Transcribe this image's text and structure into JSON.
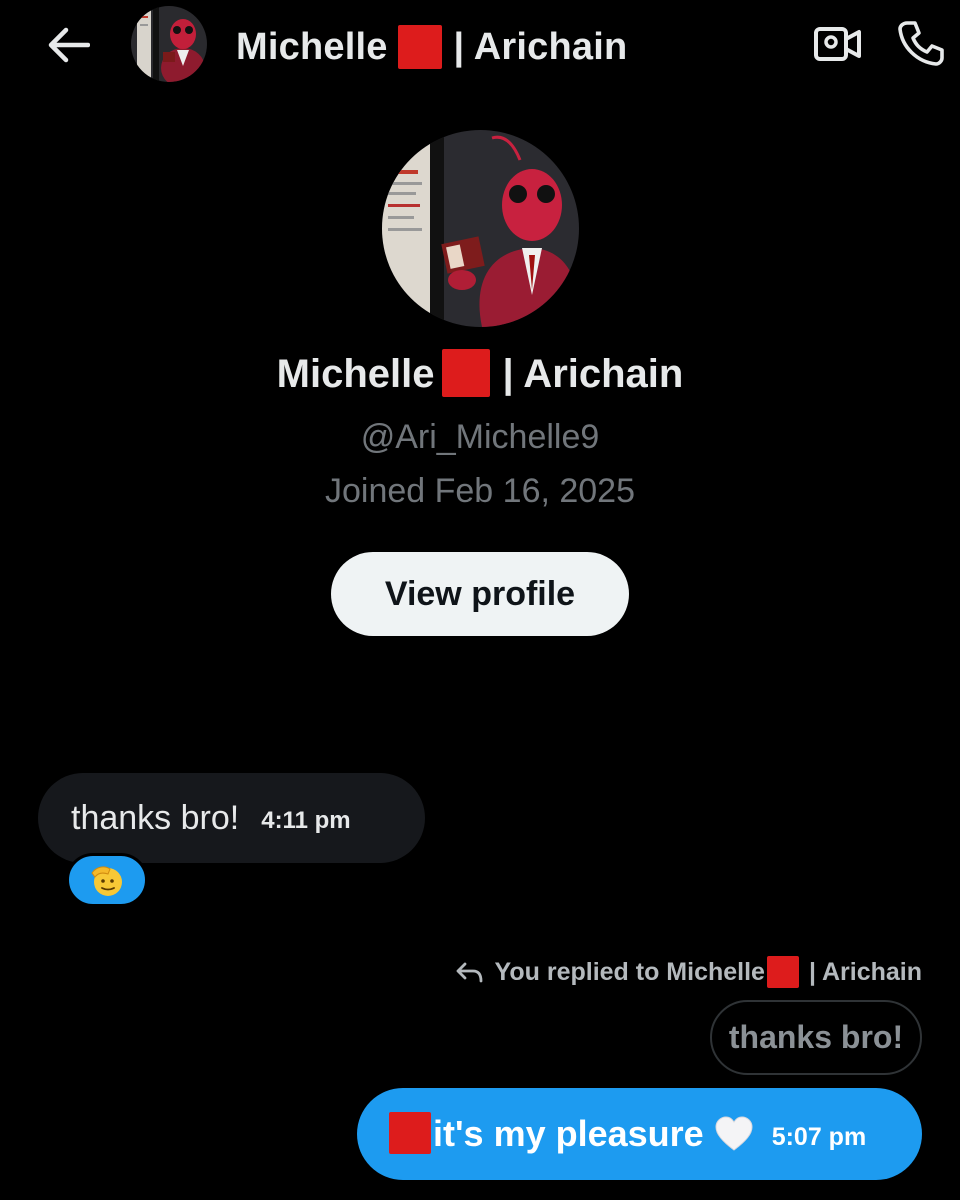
{
  "header": {
    "back_icon": "arrow-left-icon",
    "title_name": "Michelle",
    "title_suffix": "| Arichain",
    "video_icon": "video-camera-icon",
    "call_icon": "phone-icon",
    "avatar_icon": "ant-in-suit-avatar"
  },
  "profile": {
    "name": "Michelle",
    "name_suffix": "| Arichain",
    "handle": "@Ari_Michelle9",
    "joined": "Joined Feb 16, 2025",
    "view_profile_label": "View profile"
  },
  "messages": {
    "incoming": {
      "text": "thanks bro!",
      "time": "4:11 pm",
      "reaction_icon": "saluting-face-emoji"
    },
    "reply_context": {
      "prefix": "You replied to Michelle",
      "suffix": "| Arichain",
      "icon": "reply-arrow-icon",
      "quoted_text": "thanks bro!"
    },
    "outgoing": {
      "text": "it's my pleasure",
      "time": "5:07 pm",
      "heart_icon": "white-heart-emoji"
    }
  },
  "colors": {
    "background": "#000000",
    "accent_blue": "#1d9bf0",
    "red_square": "#dd1c1c",
    "muted_text": "#71767b",
    "incoming_bubble": "#16181c"
  }
}
